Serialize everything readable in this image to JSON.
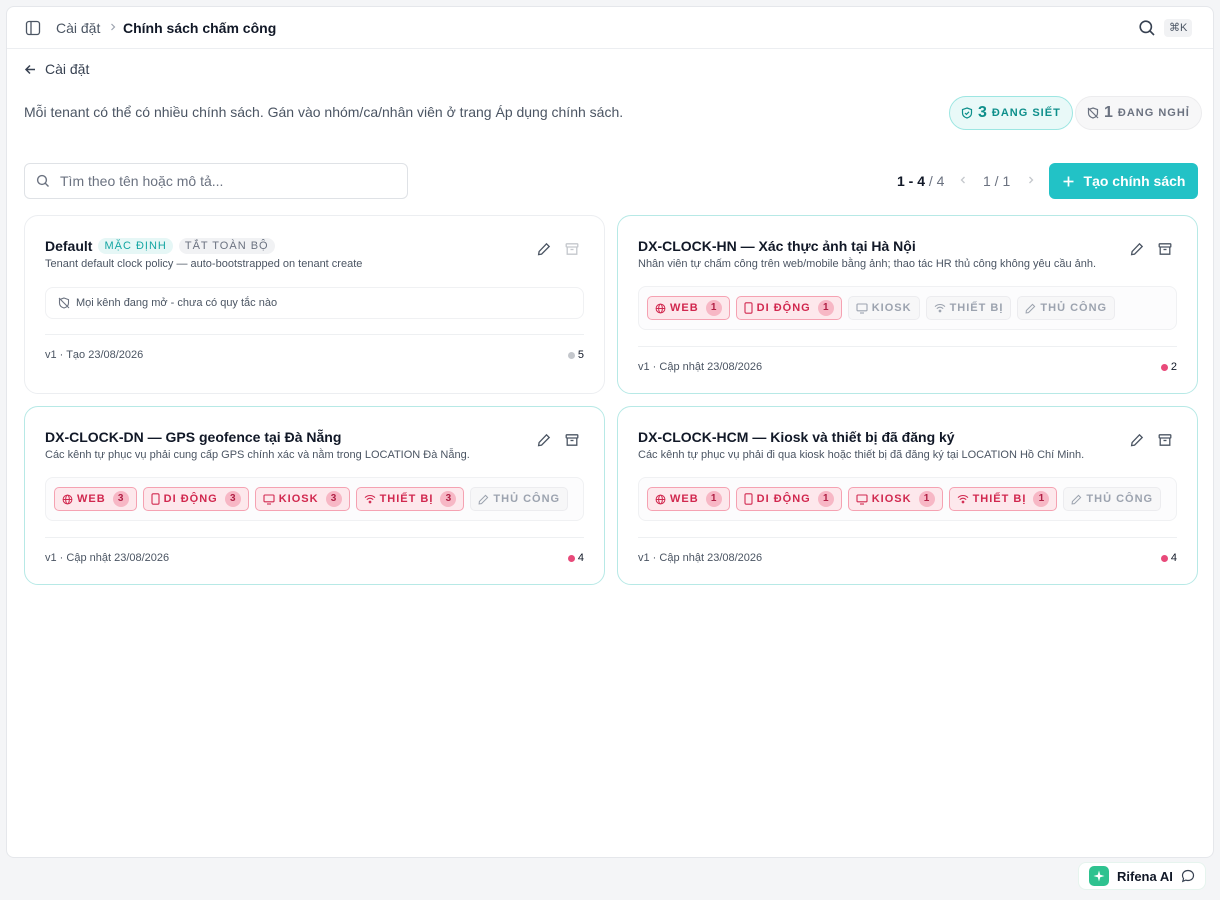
{
  "topbar": {
    "breadcrumb_root": "Cài đặt",
    "breadcrumb_current": "Chính sách chấm công",
    "shortcut": "⌘K"
  },
  "header": {
    "back_label": "Cài đặt",
    "description": "Mỗi tenant có thể có nhiều chính sách. Gán vào nhóm/ca/nhân viên ở trang Áp dụng chính sách."
  },
  "stats": {
    "active_count": "3",
    "active_label": "ĐANG SIẾT",
    "paused_count": "1",
    "paused_label": "ĐANG NGHỈ"
  },
  "toolbar": {
    "search_placeholder": "Tìm theo tên hoặc mô tả...",
    "range_bold": "1 - 4",
    "range_total": " / 4",
    "page": "1 / 1",
    "create_label": "Tạo chính sách"
  },
  "colors": {
    "accent": "#22c2c6",
    "channel_on": "#d1284f",
    "employee_dot": "#e84a7a"
  },
  "policies": [
    {
      "name": "Default",
      "tags": [
        "MẶC ĐỊNH",
        "TẮT TOÀN BỘ"
      ],
      "description": "Tenant default clock policy — auto-bootstrapped on tenant create",
      "note": "Mọi kênh đang mở - chưa có quy tắc nào",
      "footer": "v1 · Tạo 23/08/2026",
      "employees": "5"
    },
    {
      "name": "DX-CLOCK-HN — Xác thực ảnh tại Hà Nội",
      "description": "Nhân viên tự chấm công trên web/mobile bằng ảnh; thao tác HR thủ công không yêu cầu ảnh.",
      "channels": [
        {
          "label": "WEB",
          "icon": "globe-icon",
          "count": "1"
        },
        {
          "label": "DI ĐỘNG",
          "icon": "mobile-icon",
          "count": "1"
        },
        {
          "label": "KIOSK",
          "icon": "monitor-icon"
        },
        {
          "label": "THIẾT BỊ",
          "icon": "wifi-icon"
        },
        {
          "label": "THỦ CÔNG",
          "icon": "pencil-icon"
        }
      ],
      "footer": "v1 · Cập nhật 23/08/2026",
      "employees": "2"
    },
    {
      "name": "DX-CLOCK-DN — GPS geofence tại Đà Nẵng",
      "description": "Các kênh tự phục vụ phải cung cấp GPS chính xác và nằm trong LOCATION Đà Nẵng.",
      "channels": [
        {
          "label": "WEB",
          "icon": "globe-icon",
          "count": "3"
        },
        {
          "label": "DI ĐỘNG",
          "icon": "mobile-icon",
          "count": "3"
        },
        {
          "label": "KIOSK",
          "icon": "monitor-icon",
          "count": "3"
        },
        {
          "label": "THIẾT BỊ",
          "icon": "wifi-icon",
          "count": "3"
        },
        {
          "label": "THỦ CÔNG",
          "icon": "pencil-icon"
        }
      ],
      "footer": "v1 · Cập nhật 23/08/2026",
      "employees": "4"
    },
    {
      "name": "DX-CLOCK-HCM — Kiosk và thiết bị đã đăng ký",
      "description": "Các kênh tự phục vụ phải đi qua kiosk hoặc thiết bị đã đăng ký tại LOCATION Hồ Chí Minh.",
      "channels": [
        {
          "label": "WEB",
          "icon": "globe-icon",
          "count": "1"
        },
        {
          "label": "DI ĐỘNG",
          "icon": "mobile-icon",
          "count": "1"
        },
        {
          "label": "KIOSK",
          "icon": "monitor-icon",
          "count": "1"
        },
        {
          "label": "THIẾT BỊ",
          "icon": "wifi-icon",
          "count": "1"
        },
        {
          "label": "THỦ CÔNG",
          "icon": "pencil-icon"
        }
      ],
      "footer": "v1 · Cập nhật 23/08/2026",
      "employees": "4"
    }
  ],
  "assistant": {
    "label": "Rifena AI"
  }
}
